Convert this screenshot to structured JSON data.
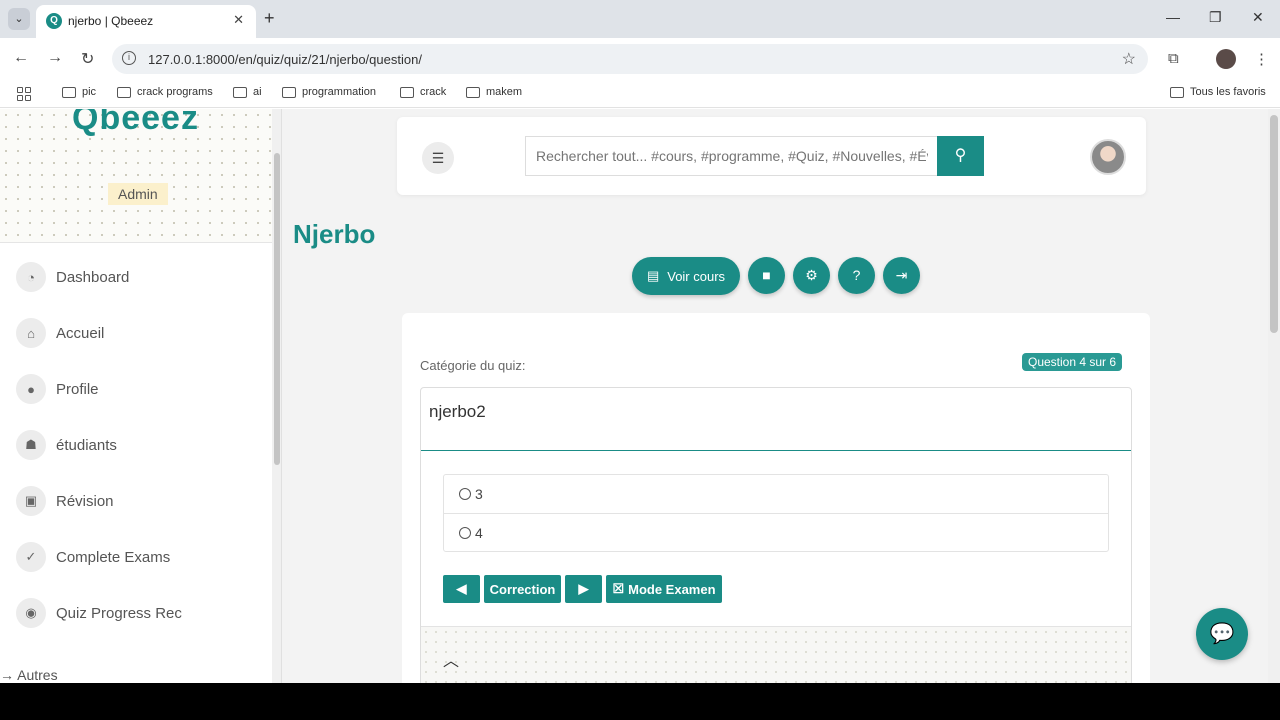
{
  "browser": {
    "tab_title": "njerbo | Qbeeez",
    "favicon_letter": "Q",
    "url": "127.0.0.1:8000/en/quiz/quiz/21/njerbo/question/",
    "bookmarks": [
      "pic",
      "crack programs",
      "ai",
      "programmation",
      "crack",
      "makem"
    ],
    "all_bookmarks": "Tous les favoris"
  },
  "sidebar": {
    "logo": "Qbeeez",
    "role_badge": "Admin",
    "items": [
      {
        "label": "Dashboard",
        "icon": "dashboard-icon"
      },
      {
        "label": "Accueil",
        "icon": "home-icon"
      },
      {
        "label": "Profile",
        "icon": "user-icon"
      },
      {
        "label": "étudiants",
        "icon": "students-icon"
      },
      {
        "label": "Révision",
        "icon": "book-icon"
      },
      {
        "label": "Complete Exams",
        "icon": "check-icon"
      },
      {
        "label": "Quiz Progress Rec",
        "icon": "progress-icon"
      }
    ],
    "autres": "→ Autres"
  },
  "header": {
    "search_placeholder": "Rechercher tout... #cours, #programme, #Quiz, #Nouvelles, #Év"
  },
  "main": {
    "page_title": "Njerbo",
    "voir_cours": "Voir cours",
    "quiz": {
      "category_label": "Catégorie du quiz:",
      "progress": "Question 4 sur 6",
      "question": "njerbo2",
      "options": [
        "3",
        "4"
      ],
      "correction_label": "Correction",
      "mode_examen_label": "Mode Examen"
    }
  },
  "colors": {
    "accent": "#1a8c86",
    "badge": "#2a9a94"
  }
}
